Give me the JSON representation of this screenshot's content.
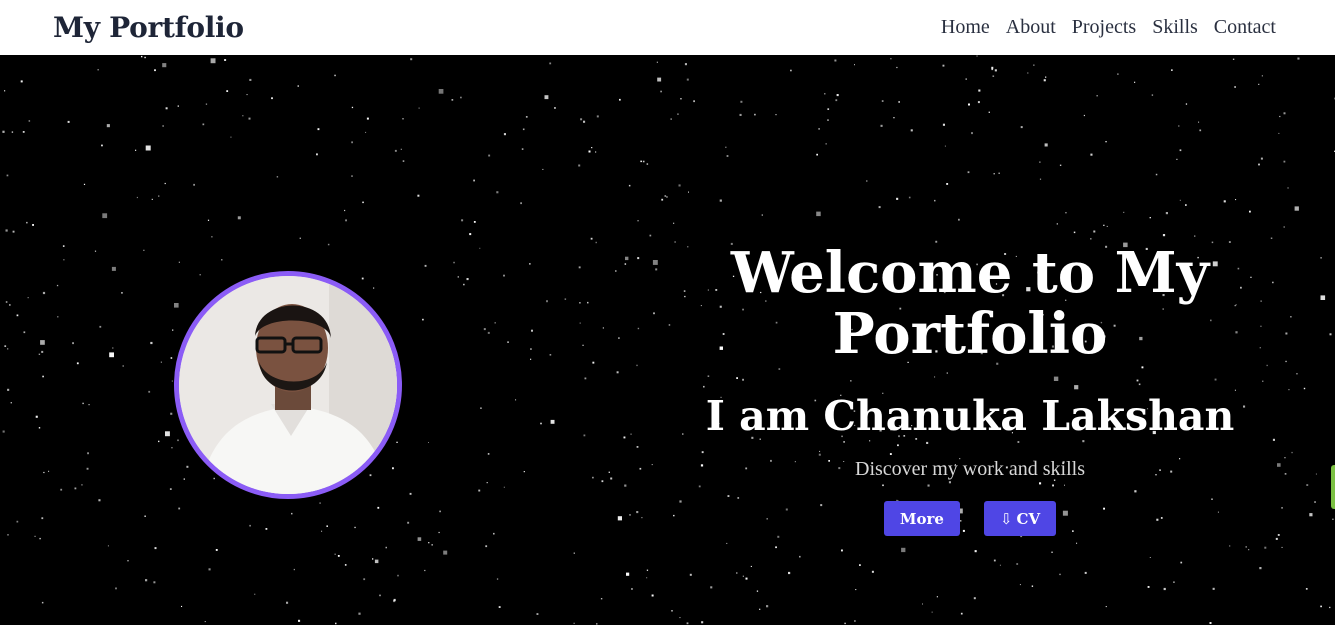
{
  "header": {
    "brand": "My Portfolio",
    "nav": [
      "Home",
      "About",
      "Projects",
      "Skills",
      "Contact"
    ]
  },
  "hero": {
    "title": "Welcome to My Portfolio",
    "subtitle": "I am Chanuka Lakshan",
    "tagline": "Discover my work and skills",
    "buttons": {
      "more": "More",
      "cv_icon": "⇩",
      "cv": "CV"
    }
  },
  "colors": {
    "accent": "#4f46e5",
    "ring": "#8b5cf6",
    "background": "#000000",
    "nav_bg": "#ffffff"
  },
  "icons": [
    "download-arrow-icon"
  ]
}
